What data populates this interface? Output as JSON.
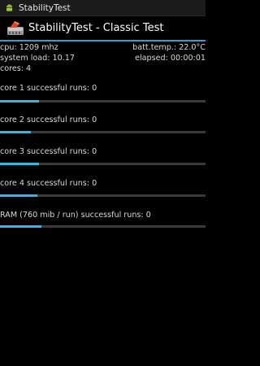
{
  "status_bar": {
    "title": "StabilityTest",
    "icon": "android-notification-icon"
  },
  "action_bar": {
    "title": "StabilityTest - Classic Test",
    "icon": "stabilitytest-app-icon",
    "accent_color": "#33b5e5"
  },
  "info": {
    "cpu": "cpu: 1209 mhz",
    "batt_temp": "batt.temp.: 22.0°C",
    "system_load": "system load: 10.17",
    "elapsed": "elapsed: 00:00:01",
    "cores": "cores: 4"
  },
  "tests": [
    {
      "label": "core 1 successful runs: 0",
      "progress": 0.19
    },
    {
      "label": "core 2 successful runs: 0",
      "progress": 0.15
    },
    {
      "label": "core 3 successful runs: 0",
      "progress": 0.19
    },
    {
      "label": "core 4 successful runs: 0",
      "progress": 0.18
    },
    {
      "label": "RAM (760 mib / run) successful runs: 0",
      "progress": 0.2
    }
  ]
}
